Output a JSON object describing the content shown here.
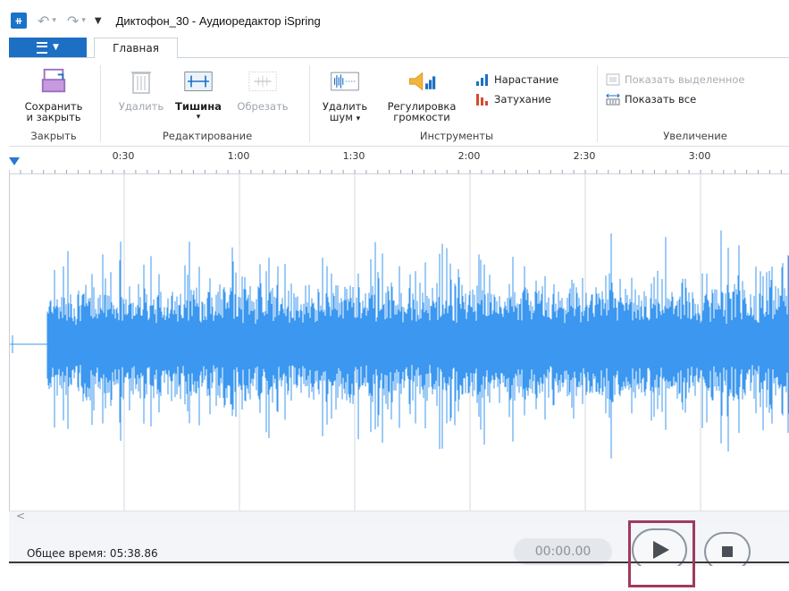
{
  "window": {
    "title": "Диктофон_30 - Аудиоредактор iSpring",
    "app_icon_glyph": "⧺"
  },
  "tabs": {
    "home_label": "Главная"
  },
  "ribbon": {
    "groups": {
      "close": "Закрыть",
      "edit": "Редактирование",
      "tools": "Инструменты",
      "zoom": "Увеличение"
    },
    "buttons": {
      "save_close_line1": "Сохранить",
      "save_close_line2": "и закрыть",
      "delete": "Удалить",
      "silence": "Тишина",
      "trim": "Обрезать",
      "noise_line1": "Удалить",
      "noise_line2": "шум",
      "volume_line1": "Регулировка",
      "volume_line2": "громкости",
      "fade_in": "Нарастание",
      "fade_out": "Затухание",
      "show_selected": "Показать выделенное",
      "show_all": "Показать все"
    }
  },
  "timeline": {
    "ticks": [
      "0:30",
      "1:00",
      "1:30",
      "2:00",
      "2:30",
      "3:00"
    ]
  },
  "status": {
    "total_time": "Общее время: 05:38.86",
    "position": "00:00.00"
  },
  "colors": {
    "accent": "#1d6fc4",
    "waveform": "#3b97ef",
    "highlight": "#a03a5c"
  }
}
